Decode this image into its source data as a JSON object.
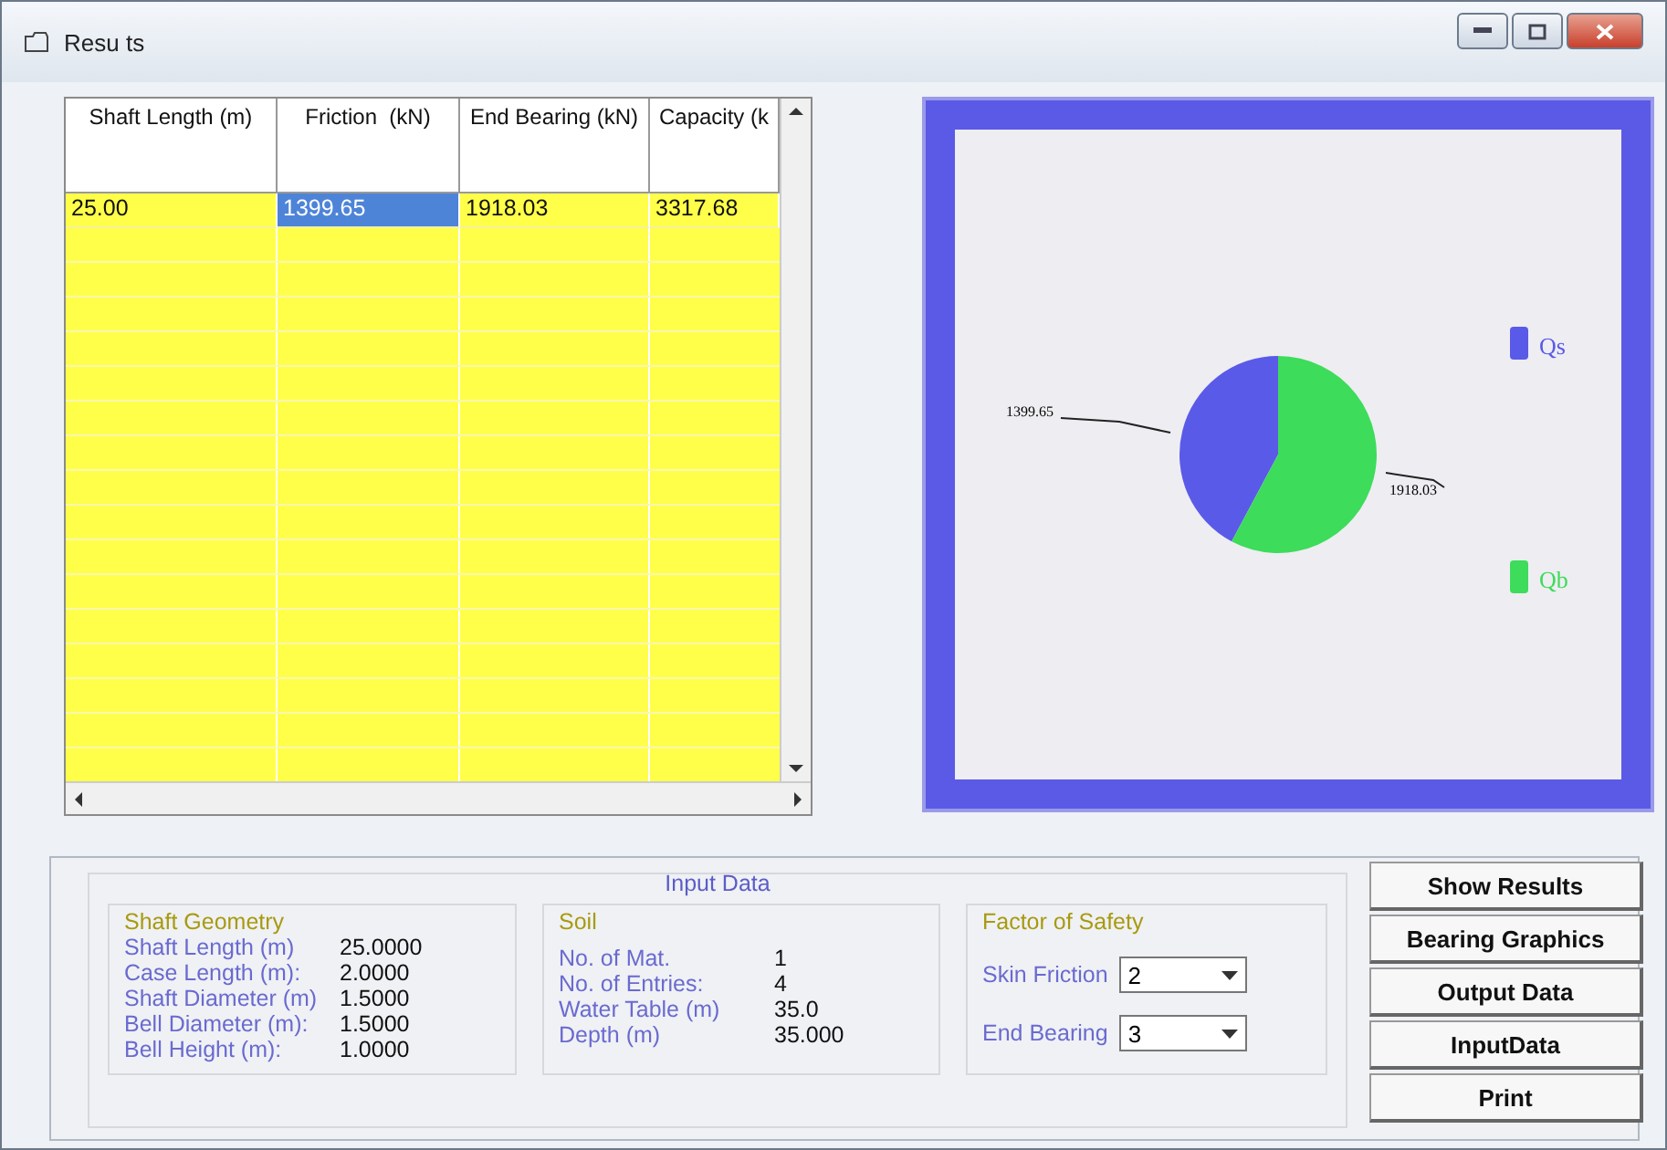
{
  "window": {
    "title": "Resu ts"
  },
  "table": {
    "columns": [
      "Shaft Length (m)",
      "Friction  (kN)",
      "End Bearing (kN)",
      "Capacity (k"
    ],
    "rows": [
      {
        "cells": [
          {
            "text": "25.00",
            "selected": false
          },
          {
            "text": "1399.65",
            "selected": true
          },
          {
            "text": "1918.03",
            "selected": false
          },
          {
            "text": "3317.68",
            "selected": false
          }
        ]
      }
    ]
  },
  "chart": {
    "chart_data": {
      "type": "pie",
      "categories": [
        "Qs",
        "Qb"
      ],
      "values": [
        1399.65,
        1918.03
      ],
      "legend": "right",
      "colors": [
        "#5a5ae8",
        "#3ddc5a"
      ],
      "value_labels": [
        "1399.65",
        "1918.03"
      ]
    }
  },
  "input_data": {
    "title": "Input Data",
    "groups": [
      {
        "title": "Shaft Geometry",
        "rows": [
          {
            "label": "Shaft Length (m)",
            "value": "25.0000"
          },
          {
            "label": "Case Length (m):",
            "value": "2.0000"
          },
          {
            "label": "Shaft Diameter (m)",
            "value": "1.5000"
          },
          {
            "label": "Bell Diameter (m):",
            "value": "1.5000"
          },
          {
            "label": "Bell Height (m):",
            "value": "1.0000"
          }
        ]
      },
      {
        "title": "Soil",
        "rows": [
          {
            "label": "No. of Mat.",
            "value": "1"
          },
          {
            "label": "No. of Entries:",
            "value": "4"
          },
          {
            "label": "Water Table (m)",
            "value": "35.0"
          },
          {
            "label": "Depth (m)",
            "value": "35.000"
          }
        ]
      }
    ],
    "safety": {
      "title": "Factor of Safety",
      "fields": [
        {
          "label": "Skin Friction",
          "value": "2"
        },
        {
          "label": "End Bearing",
          "value": "3"
        }
      ]
    }
  },
  "buttons": [
    "Show Results",
    "Bearing Graphics",
    "Output Data",
    "InputData",
    "Print"
  ]
}
